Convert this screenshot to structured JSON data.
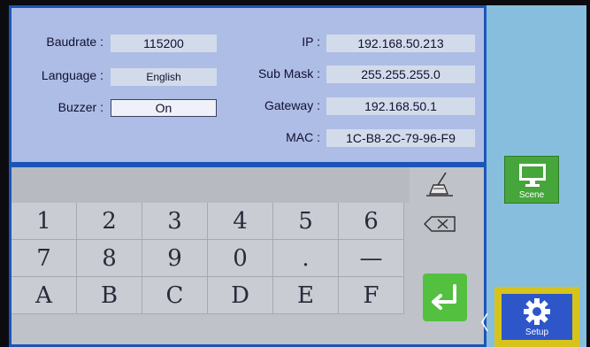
{
  "settings": {
    "baudrate": {
      "label": "Baudrate :",
      "value": "115200"
    },
    "language": {
      "label": "Language :",
      "value": "English"
    },
    "buzzer": {
      "label": "Buzzer :",
      "value": "On"
    },
    "ip": {
      "label": "IP :",
      "value": "192.168.50.213"
    },
    "sub_mask": {
      "label": "Sub Mask :",
      "value": "255.255.255.0"
    },
    "gateway": {
      "label": "Gateway :",
      "value": "192.168.50.1"
    },
    "mac": {
      "label": "MAC :",
      "value": "1C-B8-2C-79-96-F9"
    }
  },
  "keypad": {
    "row1": [
      "1",
      "2",
      "3",
      "4",
      "5",
      "6"
    ],
    "row2": [
      "7",
      "8",
      "9",
      "0",
      ".",
      "—"
    ],
    "row3": [
      "A",
      "B",
      "C",
      "D",
      "E",
      "F"
    ],
    "icons": {
      "clear": "broom-icon",
      "backspace": "backspace-icon",
      "enter": "enter-icon"
    }
  },
  "nav": {
    "scene": {
      "label": "Scene",
      "icon": "monitor-icon"
    },
    "setup": {
      "label": "Setup",
      "icon": "gear-icon"
    },
    "chevron_icon": "chevron-left-icon"
  },
  "colors": {
    "panel_bg": "#aebde6",
    "keypad_bg": "#bfc2c9",
    "border": "#1c55b8",
    "right_bar": "#88bedd",
    "enter_green": "#53c040",
    "scene_green": "#46a63b",
    "setup_blue": "#2d57c8",
    "setup_highlight": "#d8c31c"
  }
}
